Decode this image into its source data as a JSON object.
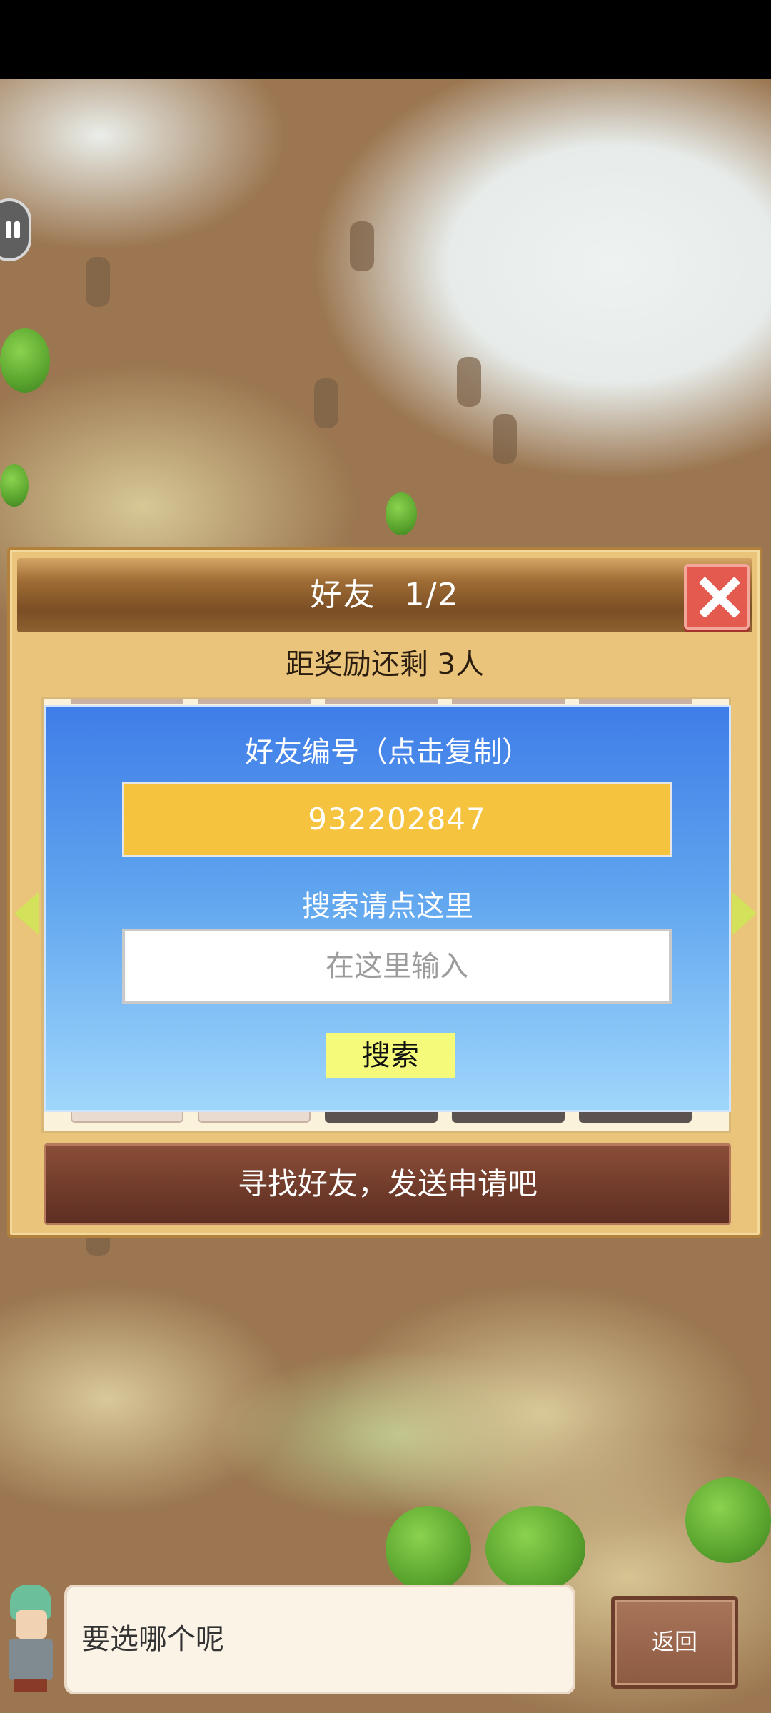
{
  "dialog": {
    "title": "好友",
    "page": "1/2",
    "reward_text": "距奖励还剩 3人",
    "find_button": "寻找好友，发送申请吧"
  },
  "id_panel": {
    "id_label": "好友编号（点击复制）",
    "id_value": "932202847",
    "search_label": "搜索请点这里",
    "search_placeholder": "在这里输入",
    "search_button": "搜索"
  },
  "bottom": {
    "speech": "要选哪个呢",
    "back_button": "返回"
  },
  "colors": {
    "id_box": "#f6c33e",
    "search_button": "#f6fa7a",
    "panel_top": "#3f7de8",
    "panel_bottom": "#9fd6fb",
    "close_button": "#e45a4e",
    "find_button": "#6f3a2a"
  },
  "icons": [
    "pause-icon",
    "close-icon",
    "arrow-left-icon",
    "arrow-right-icon"
  ]
}
